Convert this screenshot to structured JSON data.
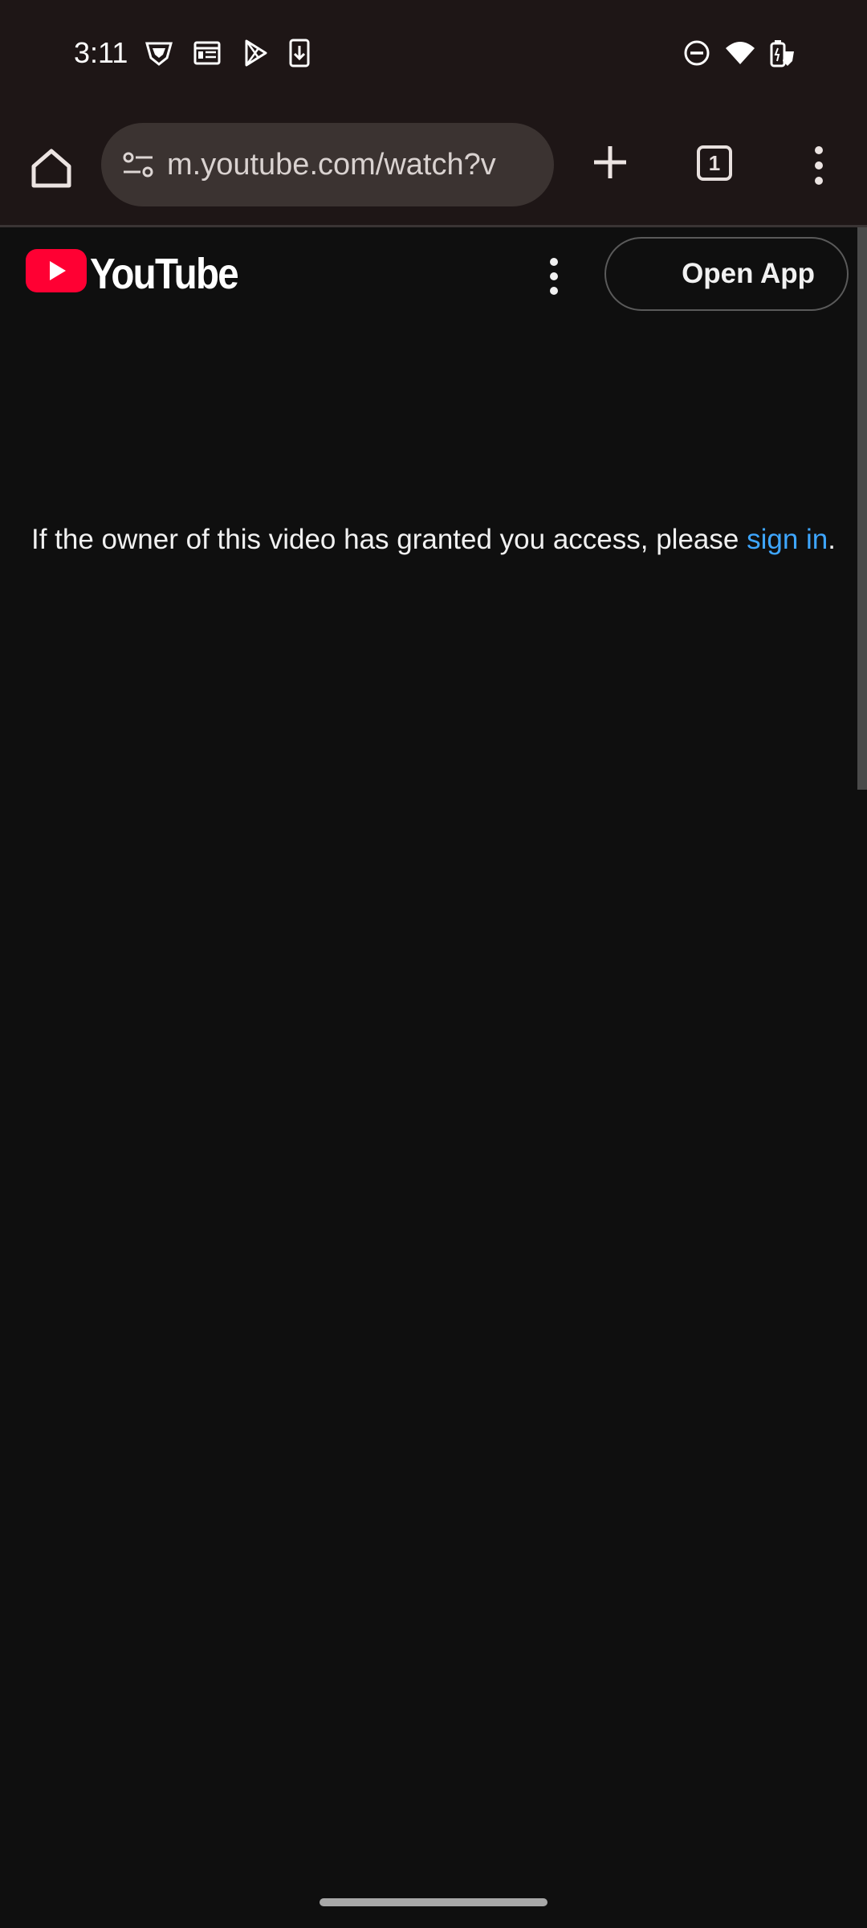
{
  "status_bar": {
    "time": "3:11",
    "left_icons": [
      "vpn-shield-icon",
      "news-icon",
      "play-store-icon",
      "download-icon"
    ],
    "right_icons": [
      "do-not-disturb-icon",
      "wifi-icon",
      "battery-icon"
    ]
  },
  "browser": {
    "url": "m.youtube.com/watch?v",
    "tab_count": "1",
    "icons": [
      "home-icon",
      "site-settings-icon",
      "new-tab-icon",
      "tab-switcher-icon",
      "more-menu-icon"
    ]
  },
  "youtube": {
    "wordmark": "YouTube",
    "open_app_label": "Open App",
    "message_prefix": "If the owner of this video has granted you access, please ",
    "sign_in_link": "sign in",
    "message_suffix": ".",
    "brand_color": "#ff0033",
    "link_color": "#3ea6ff"
  }
}
